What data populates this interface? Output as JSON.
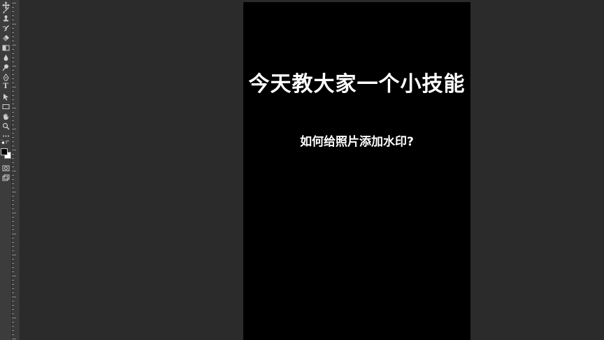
{
  "toolbar": {
    "tools": [
      {
        "name": "move-tool",
        "glyph": "✥"
      },
      {
        "name": "brush-tool",
        "glyph": "✎"
      },
      {
        "name": "clone-stamp-tool",
        "glyph": "⊥"
      },
      {
        "name": "history-brush-tool",
        "glyph": "↺"
      },
      {
        "name": "eraser-tool",
        "glyph": "◈"
      },
      {
        "name": "gradient-tool",
        "glyph": "▥"
      },
      {
        "name": "blur-tool",
        "glyph": "💧"
      },
      {
        "name": "dodge-tool",
        "glyph": "●"
      },
      {
        "name": "pen-tool",
        "glyph": "✒"
      },
      {
        "name": "type-tool",
        "glyph": "T"
      },
      {
        "name": "path-selection-tool",
        "glyph": "➤"
      },
      {
        "name": "rectangle-tool",
        "glyph": "▭"
      },
      {
        "name": "hand-tool",
        "glyph": "✋"
      },
      {
        "name": "zoom-tool",
        "glyph": "🔍"
      },
      {
        "name": "more-tools",
        "glyph": "⋯"
      }
    ],
    "colors": {
      "foreground": "#000000",
      "background": "#ffffff"
    }
  },
  "canvas": {
    "background": "#000000",
    "headline": "今天教大家一个小技能",
    "subline": "如何给照片添加水印?"
  }
}
